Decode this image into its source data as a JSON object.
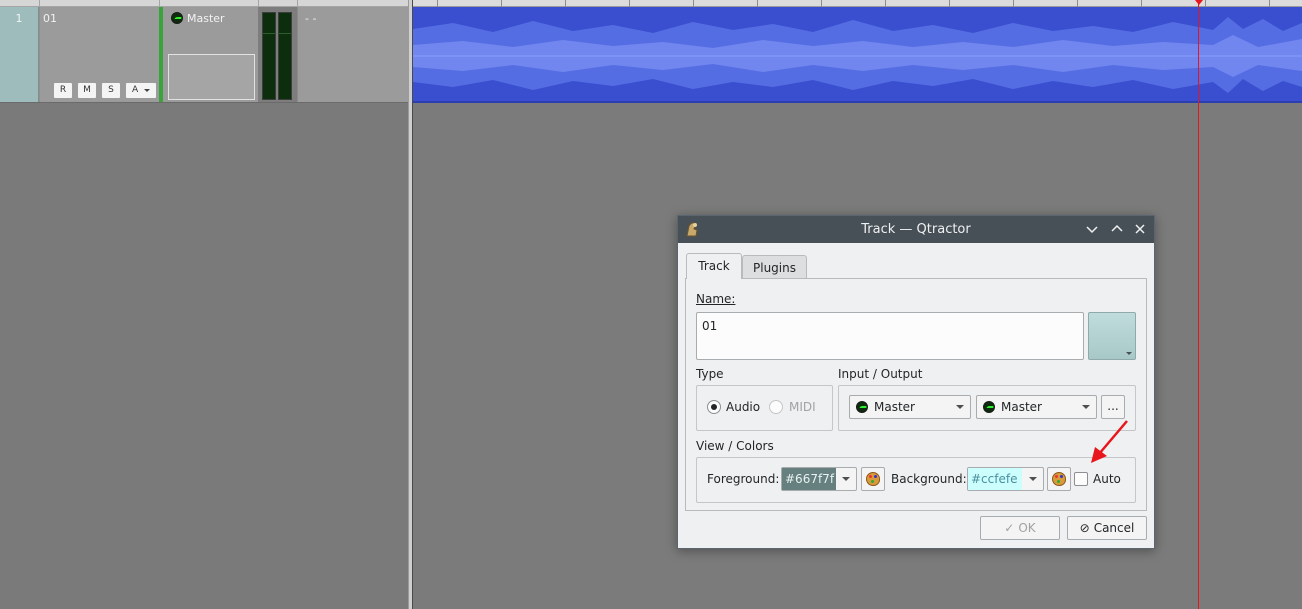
{
  "track_list": {
    "track": {
      "number": "1",
      "name": "01",
      "buttons": {
        "record": "R",
        "mute": "M",
        "solo": "S",
        "automation": "A"
      },
      "bus": "Master",
      "extra": "- -"
    }
  },
  "dialog": {
    "title": "Track — Qtractor",
    "tabs": {
      "track": "Track",
      "plugins": "Plugins"
    },
    "name_label": "Name:",
    "name_value": "01",
    "type": {
      "label": "Type",
      "audio": "Audio",
      "midi": "MIDI",
      "selected": "Audio"
    },
    "io": {
      "label": "Input / Output",
      "input": "Master",
      "output": "Master",
      "more": "..."
    },
    "view_colors": {
      "label": "View / Colors",
      "foreground_label": "Foreground:",
      "foreground_value": "#667f7f",
      "background_label": "Background:",
      "background_value": "#ccfefe",
      "auto_label": "Auto",
      "auto_checked": false
    },
    "buttons": {
      "ok": "OK",
      "cancel": "Cancel"
    }
  },
  "colors": {
    "accent": "#3daee9",
    "titlebar": "#475057",
    "clip": "#3a4fd0",
    "playhead": "#e8161c",
    "track_number_bg": "#9fbcbc",
    "bus_marker": "#3ba33b",
    "annotation_arrow": "#e8161c"
  }
}
